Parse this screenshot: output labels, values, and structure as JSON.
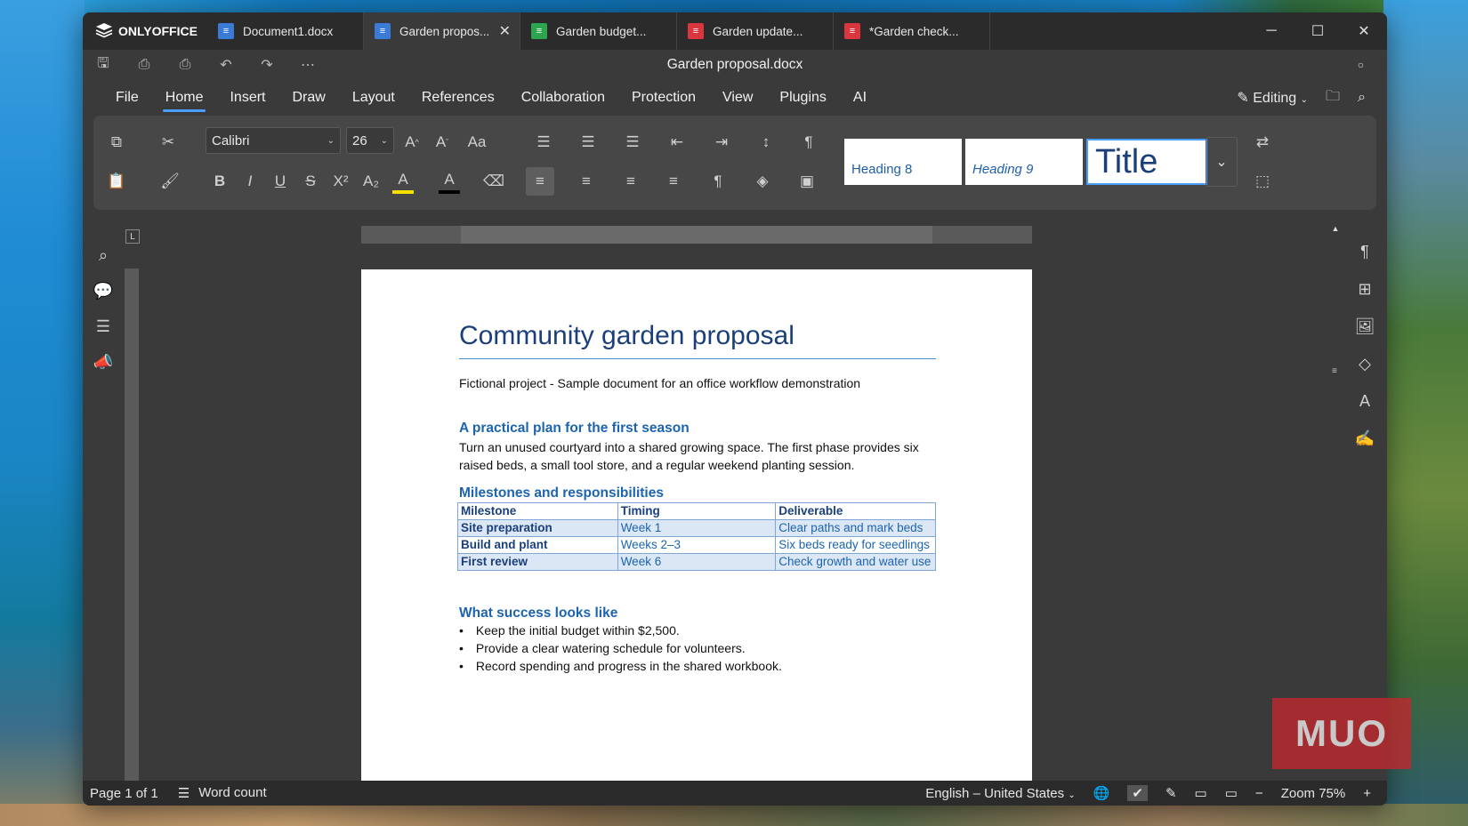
{
  "app": {
    "name": "ONLYOFFICE",
    "doc_title": "Garden proposal.docx"
  },
  "tabs": [
    {
      "label": "Document1.docx",
      "color": "#3a7bd5",
      "kind": "doc"
    },
    {
      "label": "Garden propos...",
      "color": "#3a7bd5",
      "kind": "doc",
      "close": "✕"
    },
    {
      "label": "Garden budget...",
      "color": "#2da44e",
      "kind": "sheet"
    },
    {
      "label": "Garden update...",
      "color": "#d9363e",
      "kind": "slides"
    },
    {
      "label": "*Garden check...",
      "color": "#d9363e",
      "kind": "form"
    }
  ],
  "menus": [
    "File",
    "Home",
    "Insert",
    "Draw",
    "Layout",
    "References",
    "Collaboration",
    "Protection",
    "View",
    "Plugins",
    "AI"
  ],
  "mode": "Editing",
  "ribbon": {
    "font": "Calibri",
    "size": "26",
    "styles": [
      "Heading 8",
      "Heading 9",
      "Title"
    ]
  },
  "doc": {
    "title": "Community garden proposal",
    "subtitle": "Fictional project - Sample document for an office workflow demonstration",
    "h_plan": "A practical plan for the first season",
    "plan_text": "Turn an unused courtyard into a shared growing space. The first phase provides six raised beds, a small tool store, and a regular weekend planting session.",
    "h_milestones": "Milestones and responsibilities",
    "table_header": [
      "Milestone",
      "Timing",
      "Deliverable"
    ],
    "rows": [
      [
        "Site preparation",
        "Week 1",
        "Clear paths and mark beds"
      ],
      [
        "Build and plant",
        "Weeks 2–3",
        "Six beds ready for seedlings"
      ],
      [
        "First review",
        "Week 6",
        "Check growth and water use"
      ]
    ],
    "h_success": "What success looks like",
    "bullets": [
      "Keep the initial budget within $2,500.",
      "Provide a clear watering schedule for volunteers.",
      "Record spending and progress in the shared workbook."
    ]
  },
  "status": {
    "page": "Page 1 of 1",
    "word_count": "Word count",
    "language": "English – United States",
    "zoom": "Zoom 75%"
  },
  "watermark": "MUO",
  "ruler_corner": "L"
}
